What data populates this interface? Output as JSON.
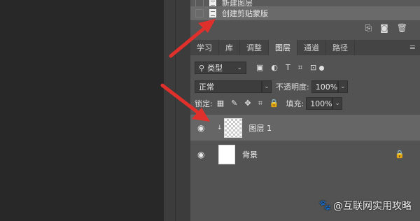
{
  "history": {
    "top_item": "新建图层",
    "selected_item": "创建剪贴蒙版",
    "tools": [
      "new-snapshot-icon",
      "camera-icon",
      "trash-icon"
    ]
  },
  "tabs": [
    {
      "label": "学习",
      "active": false
    },
    {
      "label": "库",
      "active": false
    },
    {
      "label": "调整",
      "active": false
    },
    {
      "label": "图层",
      "active": true
    },
    {
      "label": "通道",
      "active": false
    },
    {
      "label": "路径",
      "active": false
    }
  ],
  "filter": {
    "search_icon": "search-icon",
    "kind_label": "类型",
    "icons": [
      "▣",
      "◐",
      "T",
      "⌗",
      "⊡"
    ]
  },
  "blend": {
    "mode": "正常",
    "opacity_label": "不透明度:",
    "opacity_value": "100%"
  },
  "lock": {
    "label": "锁定:",
    "fill_label": "填充:",
    "fill_value": "100%"
  },
  "layers": [
    {
      "name": "图层 1",
      "selected": true,
      "clipped": true
    },
    {
      "name": "背景",
      "selected": false,
      "locked": true
    }
  ],
  "watermark": "@互联网实用攻略",
  "colors": {
    "accent_arrow": "#e0302c",
    "panel": "#535353",
    "selected": "#666666"
  }
}
